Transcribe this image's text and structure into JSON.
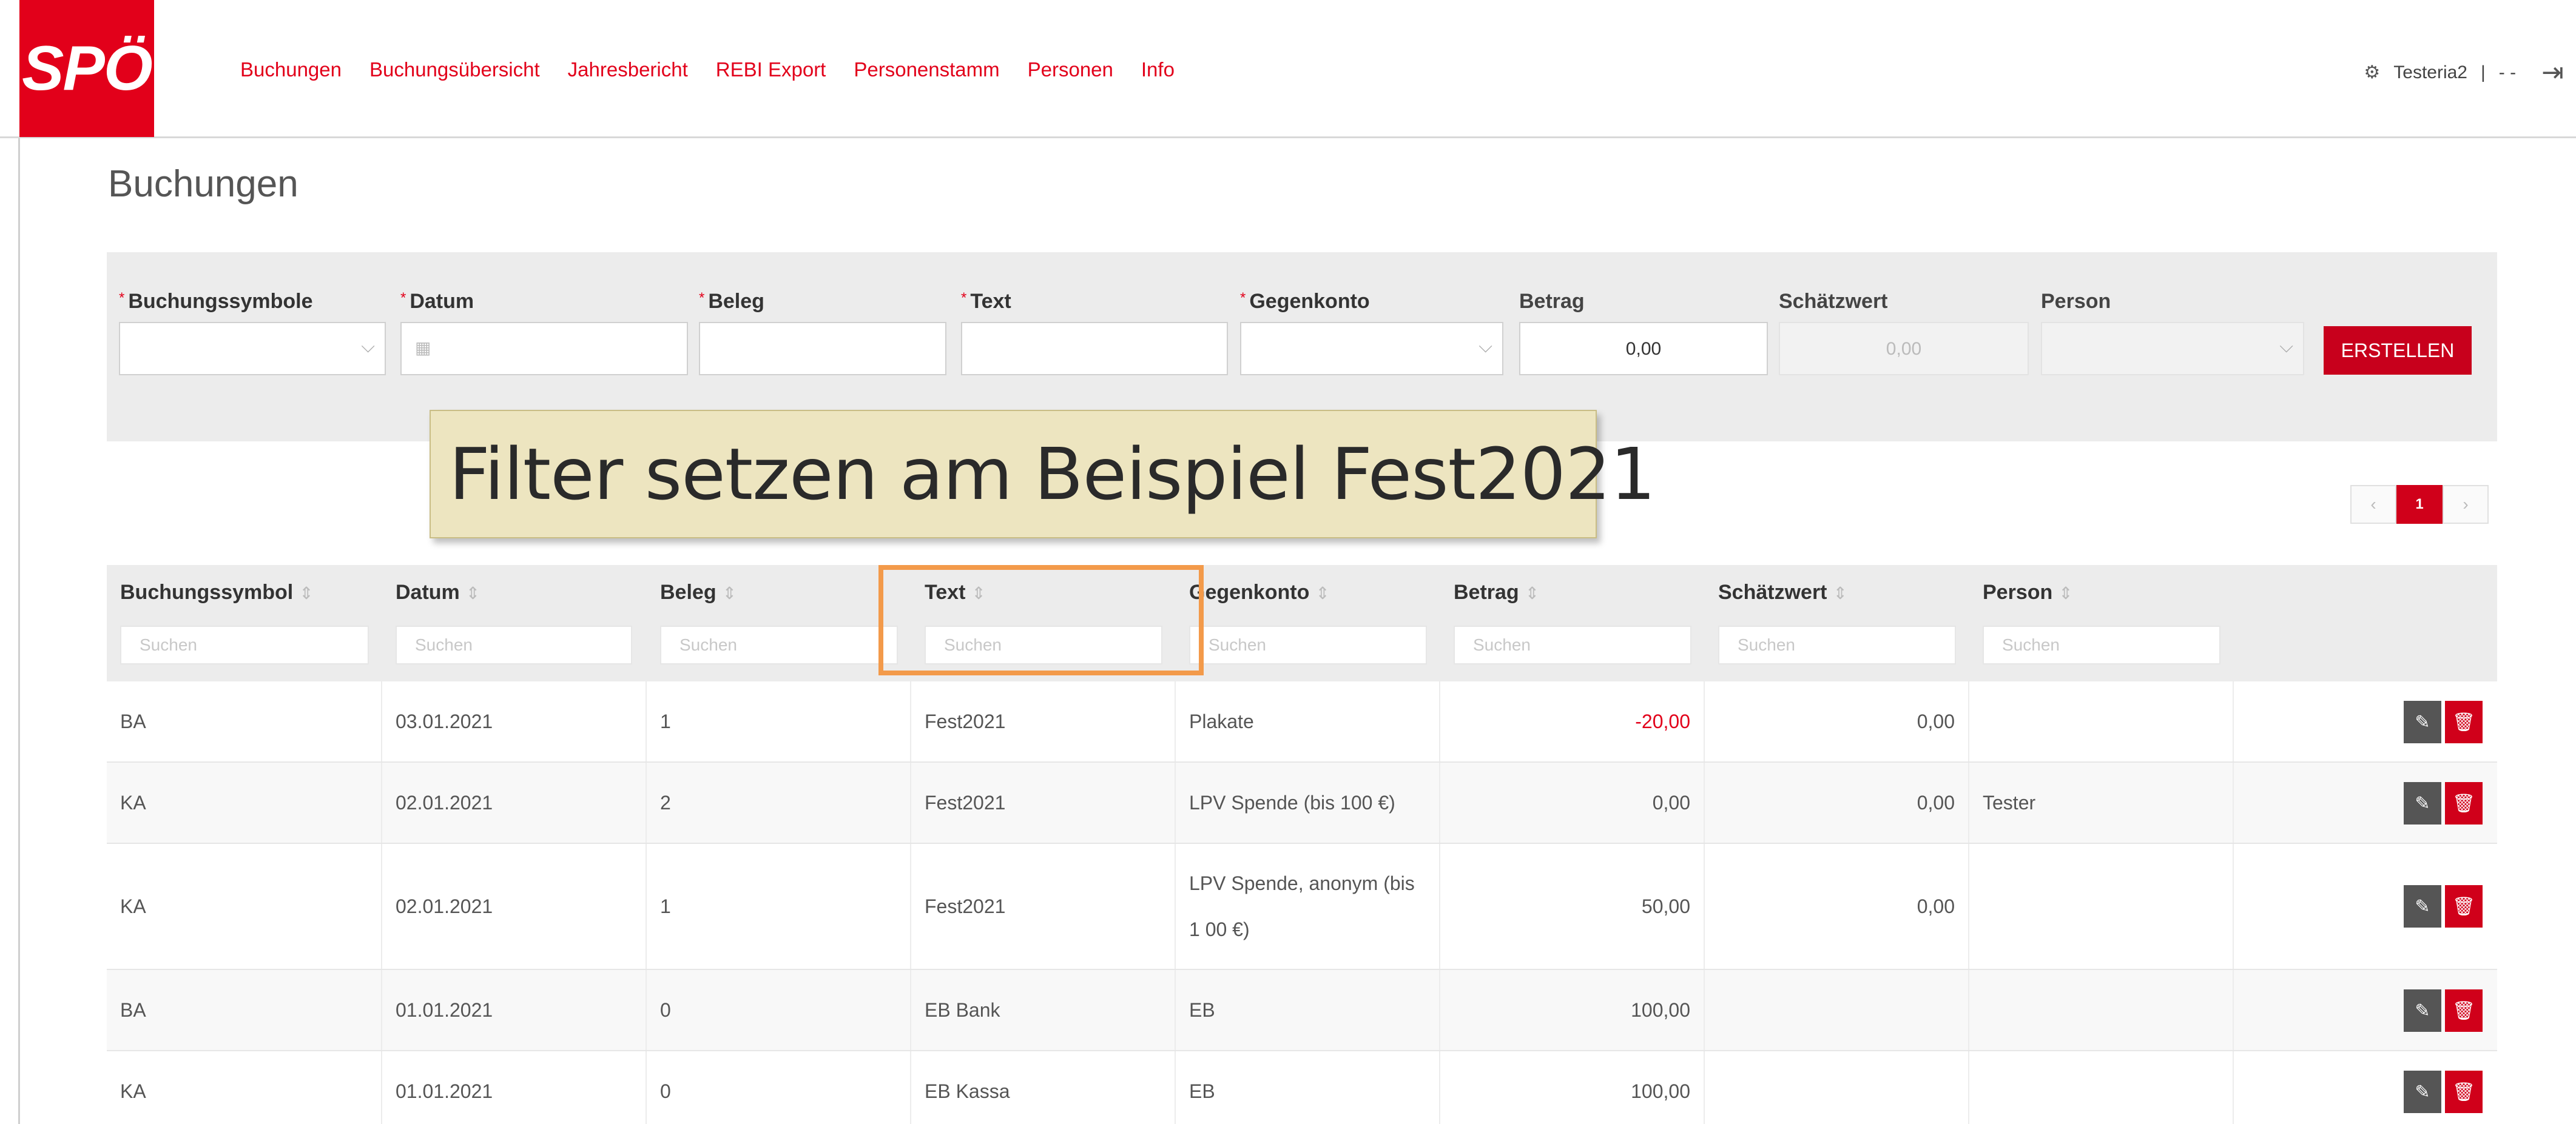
{
  "brand": {
    "logo_text": "SPÖ",
    "accent": "#e2001a"
  },
  "nav": {
    "items": [
      "Buchungen",
      "Buchungsübersicht",
      "Jahresbericht",
      "REBI Export",
      "Personenstamm",
      "Personen",
      "Info"
    ]
  },
  "user": {
    "name": "Testeria2",
    "separator": "|",
    "extra": "- -",
    "gear_icon": "gear-icon",
    "logout_icon": "logout-icon"
  },
  "page": {
    "title": "Buchungen"
  },
  "form": {
    "fields": [
      {
        "label": "Buchungssymbole",
        "required": true,
        "type": "select",
        "value": ""
      },
      {
        "label": "Datum",
        "required": true,
        "type": "date",
        "value": ""
      },
      {
        "label": "Beleg",
        "required": true,
        "type": "text",
        "value": ""
      },
      {
        "label": "Text",
        "required": true,
        "type": "text",
        "value": ""
      },
      {
        "label": "Gegenkonto",
        "required": true,
        "type": "select",
        "value": ""
      },
      {
        "label": "Betrag",
        "required": false,
        "type": "number",
        "value": "0,00"
      },
      {
        "label": "Schätzwert",
        "required": false,
        "type": "number",
        "value": "0,00",
        "disabled": true
      },
      {
        "label": "Person",
        "required": false,
        "type": "select",
        "value": "",
        "disabled": true
      }
    ],
    "create_label": "ERSTELLEN"
  },
  "annotation": {
    "text": "Filter setzen am Beispiel Fest2021"
  },
  "pagination": {
    "prev": "‹",
    "current": "1",
    "next": "›"
  },
  "table": {
    "columns": [
      "Buchungssymbol",
      "Datum",
      "Beleg",
      "Text",
      "Gegenkonto",
      "Betrag",
      "Schätzwert",
      "Person"
    ],
    "search_placeholder": "Suchen",
    "rows": [
      {
        "symbol": "BA",
        "datum": "03.01.2021",
        "beleg": "1",
        "text": "Fest2021",
        "gegenkonto": "Plakate",
        "betrag": "-20,00",
        "schaetzwert": "0,00",
        "person": ""
      },
      {
        "symbol": "KA",
        "datum": "02.01.2021",
        "beleg": "2",
        "text": "Fest2021",
        "gegenkonto": "LPV Spende (bis 100 €)",
        "betrag": "0,00",
        "schaetzwert": "0,00",
        "person": "Tester"
      },
      {
        "symbol": "KA",
        "datum": "02.01.2021",
        "beleg": "1",
        "text": "Fest2021",
        "gegenkonto": "LPV Spende, anonym (bis 1 00 €)",
        "betrag": "50,00",
        "schaetzwert": "0,00",
        "person": ""
      },
      {
        "symbol": "BA",
        "datum": "01.01.2021",
        "beleg": "0",
        "text": "EB Bank",
        "gegenkonto": "EB",
        "betrag": "100,00",
        "schaetzwert": "",
        "person": ""
      },
      {
        "symbol": "KA",
        "datum": "01.01.2021",
        "beleg": "0",
        "text": "EB Kassa",
        "gegenkonto": "EB",
        "betrag": "100,00",
        "schaetzwert": "",
        "person": ""
      }
    ]
  }
}
